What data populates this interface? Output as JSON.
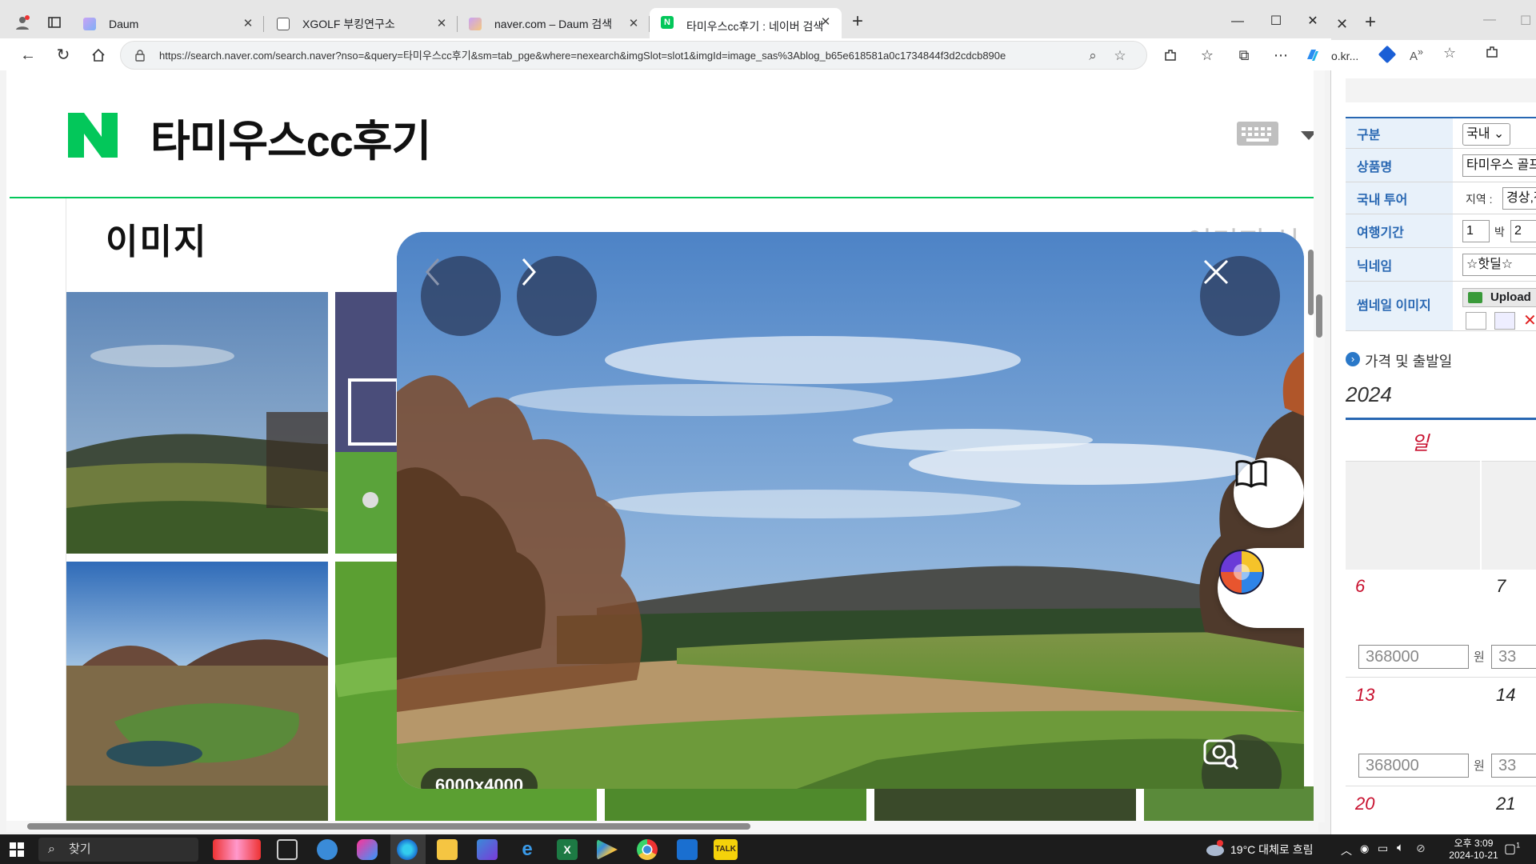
{
  "browser": {
    "tabs": [
      {
        "title": "Daum",
        "favicon_color": "#d7a6f0"
      },
      {
        "title": "XGOLF 부킹연구소",
        "favicon_color": "#555555"
      },
      {
        "title": "naver.com – Daum 검색",
        "favicon_color": "#d7a6f0"
      },
      {
        "title": "타미우스cc후기 : 네이버 검색",
        "favicon_color": "#03c75a"
      }
    ],
    "url": "https://search.naver.com/search.naver?nso=&query=타미우스cc후기&sm=tab_pge&where=nexearch&imgSlot=slot1&imgId=image_sas%3Ablog_b65e618581a0c1734844f3d2cdcb890e"
  },
  "page": {
    "query_title": "타미우스cc후기",
    "section_title": "이미지",
    "section_right_link": "이미지 신고",
    "brand_color": "#03c75a"
  },
  "viewer": {
    "size_label": "6000x4000"
  },
  "right_window": {
    "url_fragment": "o.kr...",
    "form": [
      {
        "label": "구분",
        "value": "국내"
      },
      {
        "label": "상품명",
        "value": "타미우스 골프"
      },
      {
        "label": "국내 투어",
        "prefix": "지역 :",
        "value": "경상,전"
      },
      {
        "label": "여행기간",
        "nights": "1",
        "nights_unit": "박",
        "days": "2"
      },
      {
        "label": "닉네임",
        "value": "☆핫딜☆"
      },
      {
        "label": "썸네일 이미지",
        "upload_label": "Upload"
      }
    ],
    "price_section_title": "가격 및 출발일",
    "year": "2024",
    "weekday_sun": "일",
    "calendar": [
      {
        "day": "6",
        "price": "368000",
        "unit": "원",
        "next_day": "7",
        "next_price": "33"
      },
      {
        "day": "13",
        "price": "368000",
        "unit": "원",
        "next_day": "14",
        "next_price": "33"
      },
      {
        "day": "20",
        "next_day": "21"
      }
    ]
  },
  "taskbar": {
    "search_label": "찾기",
    "weather": "19°C  대체로 흐림",
    "time": "오후 3:09",
    "date": "2024-10-21",
    "notification_count": "1"
  }
}
